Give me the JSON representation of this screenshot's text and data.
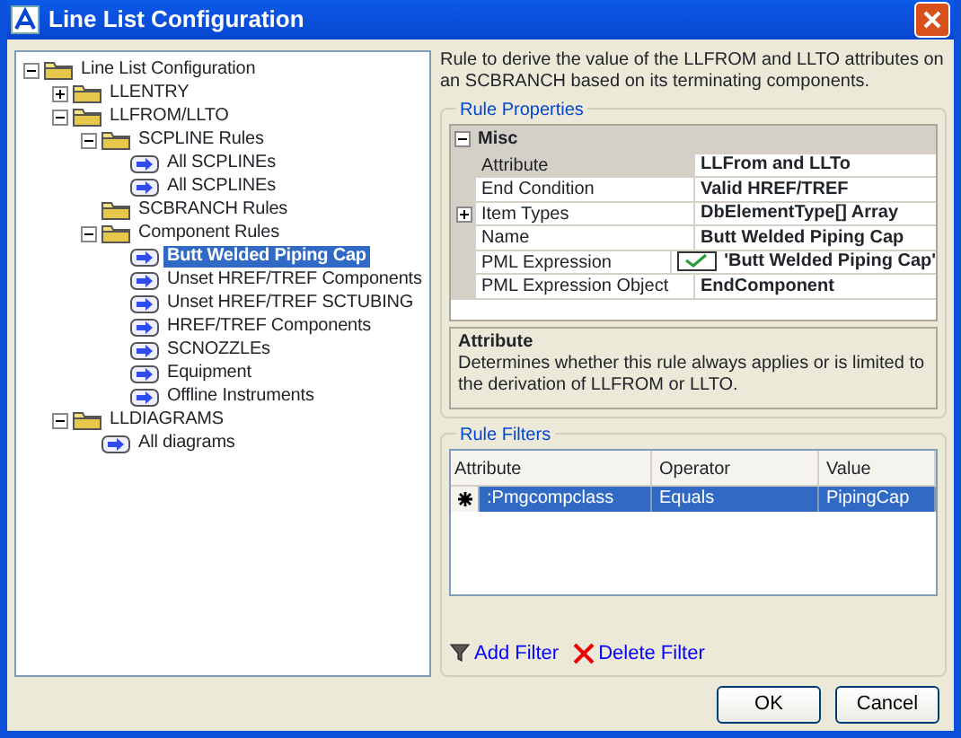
{
  "window": {
    "title": "Line List Configuration"
  },
  "tree": [
    {
      "label": "Line List Configuration",
      "kind": "folder",
      "expanded": true,
      "selected": false,
      "children": [
        {
          "label": "LLENTRY",
          "kind": "folder",
          "expanded": false,
          "selected": false
        },
        {
          "label": "LLFROM/LLTO",
          "kind": "folder",
          "expanded": true,
          "selected": false,
          "children": [
            {
              "label": "SCPLINE Rules",
              "kind": "folder",
              "expanded": true,
              "selected": false,
              "children": [
                {
                  "label": "All SCPLINEs",
                  "kind": "rule",
                  "selected": false
                },
                {
                  "label": "All SCPLINEs",
                  "kind": "rule",
                  "selected": false
                }
              ]
            },
            {
              "label": "SCBRANCH Rules",
              "kind": "folder",
              "selected": false
            },
            {
              "label": "Component Rules",
              "kind": "folder",
              "expanded": true,
              "selected": false,
              "children": [
                {
                  "label": "Butt Welded Piping Cap",
                  "kind": "rule",
                  "selected": true
                },
                {
                  "label": "Unset HREF/TREF Components",
                  "kind": "rule",
                  "selected": false
                },
                {
                  "label": "Unset HREF/TREF SCTUBING",
                  "kind": "rule",
                  "selected": false
                },
                {
                  "label": "HREF/TREF Components",
                  "kind": "rule",
                  "selected": false
                },
                {
                  "label": "SCNOZZLEs",
                  "kind": "rule",
                  "selected": false
                },
                {
                  "label": "Equipment",
                  "kind": "rule",
                  "selected": false
                },
                {
                  "label": "Offline Instruments",
                  "kind": "rule",
                  "selected": false
                }
              ]
            }
          ]
        },
        {
          "label": "LLDIAGRAMS",
          "kind": "folder",
          "expanded": true,
          "selected": false,
          "children": [
            {
              "label": "All diagrams",
              "kind": "rule",
              "selected": false
            }
          ]
        }
      ]
    }
  ],
  "description": "Rule to derive the value of the LLFROM and LLTO attributes on an SCBRANCH based on its terminating components.",
  "rule_properties": {
    "title": "Rule Properties",
    "category": {
      "label": "Misc",
      "expanded": true
    },
    "rows": [
      {
        "name": "Attribute",
        "value": "LLFrom and LLTo",
        "selected": true
      },
      {
        "name": "End Condition",
        "value": "Valid HREF/TREF",
        "selected": false
      },
      {
        "name": "Item Types",
        "value": "DbElementType[] Array",
        "selected": false,
        "expanded": false
      },
      {
        "name": "Name",
        "value": "Butt Welded Piping Cap",
        "selected": false
      },
      {
        "name": "PML Expression",
        "value": "'Butt Welded Piping Cap'",
        "selected": false,
        "valid": true
      },
      {
        "name": "PML Expression Object",
        "value": "EndComponent",
        "selected": false
      }
    ],
    "help": {
      "title": "Attribute",
      "text": "Determines whether this rule always applies or is limited to the derivation of LLFROM or LLTO."
    }
  },
  "rule_filters": {
    "title": "Rule Filters",
    "columns": [
      "Attribute",
      "Operator",
      "Value"
    ],
    "rows": [
      {
        "cells": [
          ":Pmgcompclass",
          "Equals",
          "PipingCap"
        ],
        "selected": true
      }
    ],
    "actions": [
      {
        "label": "Add Filter",
        "kind": "add"
      },
      {
        "label": "Delete Filter",
        "kind": "delete"
      }
    ]
  },
  "buttons": [
    "OK",
    "Cancel"
  ]
}
